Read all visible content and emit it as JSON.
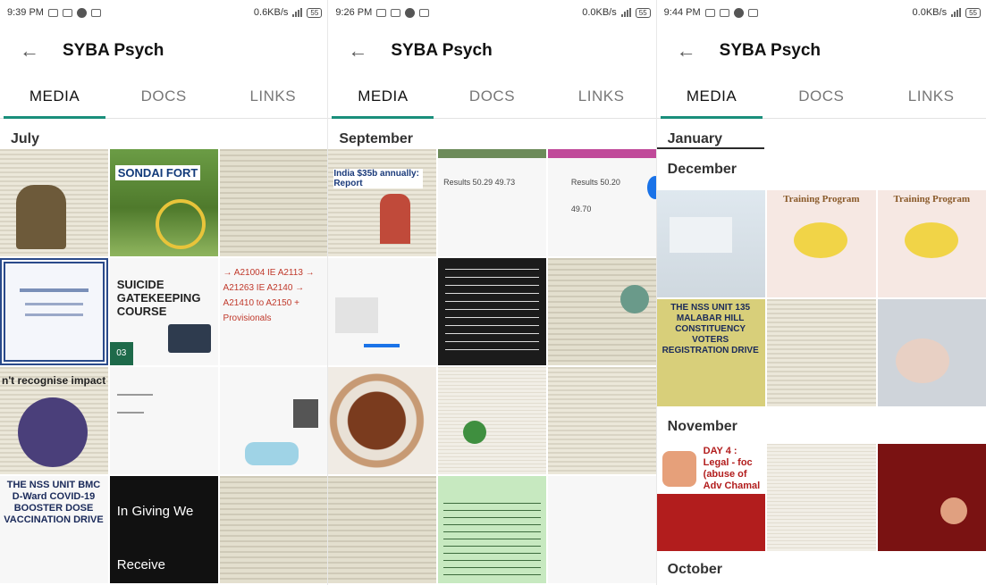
{
  "screens": [
    {
      "status": {
        "time": "9:39 PM",
        "speed": "0.6KB/s",
        "battery": "55"
      },
      "title": "SYBA Psych",
      "tabs": [
        "MEDIA",
        "DOCS",
        "LINKS"
      ],
      "sections": [
        {
          "label": "July"
        }
      ],
      "tiles": [
        {
          "text": "",
          "style": "news"
        },
        {
          "text": "SONDAI FORT",
          "style": "green"
        },
        {
          "text": "",
          "style": "news2"
        },
        {
          "text": "",
          "style": "frame"
        },
        {
          "text": "SUICIDE GATEKEEPING COURSE",
          "style": "white"
        },
        {
          "text": "→ A21004 IE A2113  → A21263 IE A2140  → A21410 to A2150 + Provisionals",
          "style": "white"
        },
        {
          "text": "n't recognise impact of",
          "style": "news"
        },
        {
          "text": "",
          "style": "white"
        },
        {
          "text": "",
          "style": "white"
        },
        {
          "text": "THE NSS UNIT BMC D-Ward COVID-19 BOOSTER DOSE VACCINATION DRIVE",
          "style": "white"
        },
        {
          "text": "In Giving We Receive",
          "style": "dark"
        },
        {
          "text": "",
          "style": "news2"
        }
      ]
    },
    {
      "status": {
        "time": "9:26 PM",
        "speed": "0.0KB/s",
        "battery": "55"
      },
      "title": "SYBA Psych",
      "tabs": [
        "MEDIA",
        "DOCS",
        "LINKS"
      ],
      "sections": [
        {
          "label": "September"
        }
      ],
      "tiles": [
        {
          "text": "India $35b annually: Report",
          "style": "news"
        },
        {
          "text": "Results 50.29 49.73",
          "style": "white"
        },
        {
          "text": "Results 50.20 49.70",
          "style": "white"
        },
        {
          "text": "",
          "style": "white"
        },
        {
          "text": "",
          "style": "darknews"
        },
        {
          "text": "",
          "style": "news2"
        },
        {
          "text": "",
          "style": "circlebg"
        },
        {
          "text": "",
          "style": "paper"
        },
        {
          "text": "",
          "style": "news"
        },
        {
          "text": "",
          "style": "news2"
        },
        {
          "text": "",
          "style": "tealbg"
        },
        {
          "text": "",
          "style": "white"
        }
      ]
    },
    {
      "status": {
        "time": "9:44 PM",
        "speed": "0.0KB/s",
        "battery": "55"
      },
      "title": "SYBA Psych",
      "tabs": [
        "MEDIA",
        "DOCS",
        "LINKS"
      ],
      "sections": [
        {
          "label": "January"
        },
        {
          "label": "December"
        },
        {
          "label": "November"
        },
        {
          "label": "October"
        }
      ],
      "december_tiles": [
        {
          "text": "",
          "style": "skytile"
        },
        {
          "text": "Training Program",
          "style": "pinkbg"
        },
        {
          "text": "Training Program",
          "style": "pinkbg"
        },
        {
          "text": "THE NSS UNIT 135 MALABAR HILL CONSTITUENCY VOTERS REGISTRATION DRIVE",
          "style": "yellowbg"
        },
        {
          "text": "",
          "style": "news"
        },
        {
          "text": "",
          "style": "bluenote"
        }
      ],
      "november_tiles": [
        {
          "text": "DAY 4 : Legal - foc (abuse of Adv Chamal",
          "style": "redbg"
        },
        {
          "text": "",
          "style": "paper"
        },
        {
          "text": "",
          "style": "maroon"
        }
      ]
    }
  ]
}
